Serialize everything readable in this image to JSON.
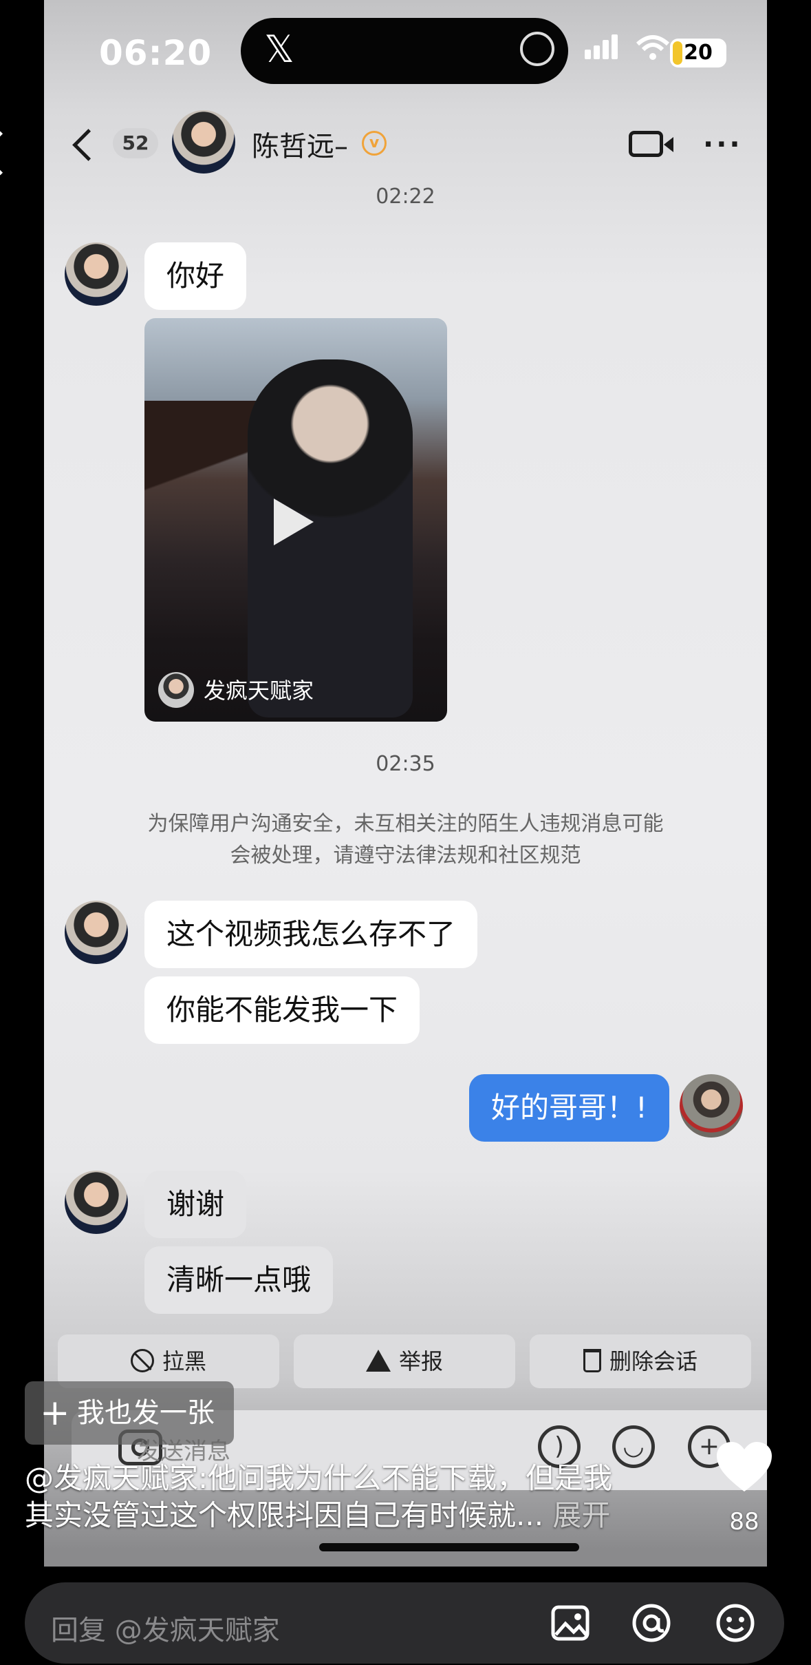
{
  "status_bar": {
    "time": "06:20",
    "battery": "20"
  },
  "header": {
    "back_badge": "52",
    "contact_name": "陈哲远–",
    "verified_mark": "v"
  },
  "messages": {
    "time1": "02:22",
    "msg_hello": "你好",
    "video_card_author": "发疯天赋家",
    "time2": "02:35",
    "notice_line1": "为保障用户沟通安全，未互相关注的陌生人违规消息可能",
    "notice_line2": "会被处理，请遵守法律法规和社区规范",
    "msg_cant_save": "这个视频我怎么存不了",
    "msg_send_me": "你能不能发我一下",
    "msg_reply_ok": "好的哥哥！!",
    "msg_thanks": "谢谢",
    "msg_clearer": "清晰一点哦"
  },
  "actions": {
    "block": "拉黑",
    "report": "举报",
    "delete": "删除会话"
  },
  "input": {
    "placeholder": "发送消息"
  },
  "overlay": {
    "post_button": "我也发一张",
    "caption_line1": "@发疯天赋家:他问我为什么不能下载，但是我",
    "caption_line2": "其实没管过这个权限抖因自己有时候就...",
    "expand": "展开",
    "like_count": "88"
  },
  "reply": {
    "placeholder": "回复 @发疯天赋家"
  },
  "icons": [
    "back-icon",
    "video-call-icon",
    "more-icon",
    "play-icon",
    "block-icon",
    "warning-icon",
    "trash-icon",
    "camera-icon",
    "voice-icon",
    "emoji-icon",
    "plus-icon",
    "heart-icon",
    "image-icon",
    "at-icon",
    "smile-icon"
  ],
  "colors": {
    "sent_bubble": "#3b82e8",
    "verified": "#f0a33a",
    "battery_level": "#f2c52b"
  }
}
